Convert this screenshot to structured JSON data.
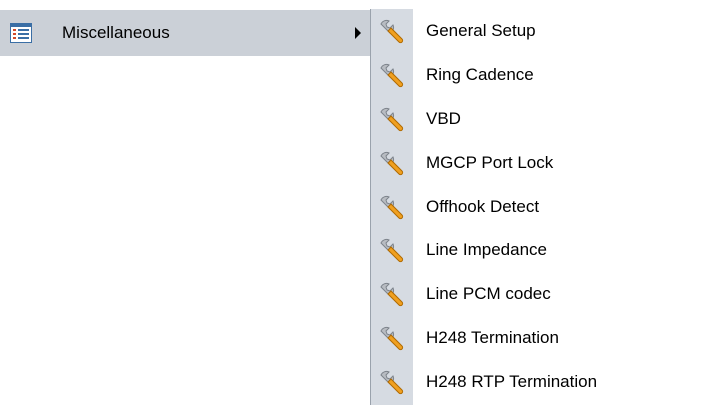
{
  "menu": {
    "parent": {
      "label": "Miscellaneous",
      "icon": "list-icon"
    },
    "submenu": [
      {
        "label": "General Setup",
        "icon": "wrench-icon"
      },
      {
        "label": "Ring Cadence",
        "icon": "wrench-icon"
      },
      {
        "label": "VBD",
        "icon": "wrench-icon"
      },
      {
        "label": "MGCP Port Lock",
        "icon": "wrench-icon"
      },
      {
        "label": "Offhook Detect",
        "icon": "wrench-icon"
      },
      {
        "label": "Line Impedance",
        "icon": "wrench-icon"
      },
      {
        "label": "Line PCM codec",
        "icon": "wrench-icon"
      },
      {
        "label": "H248 Termination",
        "icon": "wrench-icon"
      },
      {
        "label": "H248 RTP Termination",
        "icon": "wrench-icon"
      }
    ]
  },
  "colors": {
    "parent_highlight": "#cbd0d7",
    "submenu_gutter": "#d6dbe2",
    "wrench_handle": "#f0a020",
    "wrench_head": "#b8bcc2"
  }
}
